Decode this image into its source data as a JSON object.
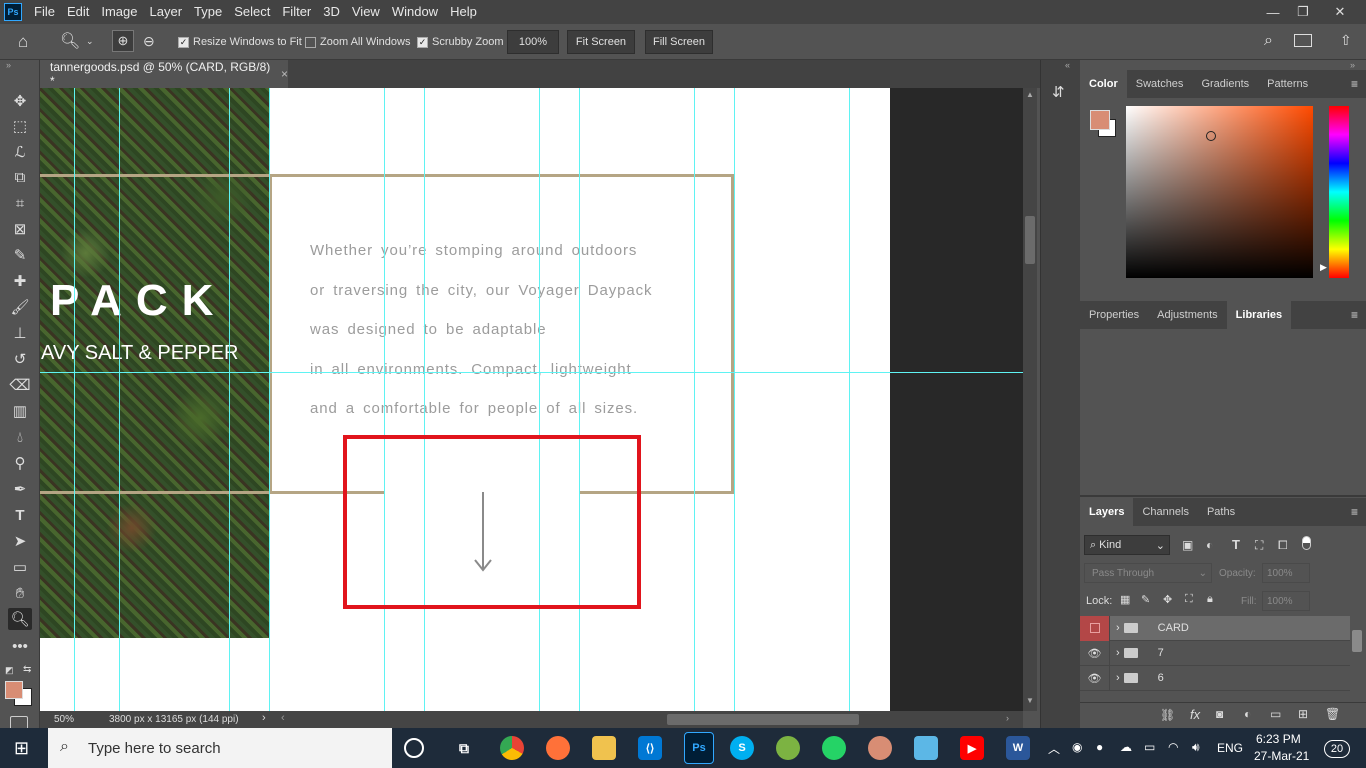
{
  "app": {
    "logo": "Ps",
    "menu": [
      "File",
      "Edit",
      "Image",
      "Layer",
      "Type",
      "Select",
      "Filter",
      "3D",
      "View",
      "Window",
      "Help"
    ],
    "window_controls": [
      "—",
      "❐",
      "✕"
    ]
  },
  "options_bar": {
    "resize_windows": "Resize Windows to Fit",
    "zoom_all": "Zoom All Windows",
    "scrubby_zoom": "Scrubby Zoom",
    "zoom_value": "100%",
    "fit_screen": "Fit Screen",
    "fill_screen": "Fill Screen"
  },
  "document": {
    "tab_title": "tannergoods.psd @ 50% (CARD, RGB/8) *",
    "close": "×",
    "heading": "PACK",
    "subheading": "AVY SALT & PEPPER",
    "paragraph": [
      "Whether you’re stomping around outdoors",
      "or traversing the city, our Voyager Daypack",
      "was designed to be adaptable",
      "in all environments. Compact, lightweight",
      "and a comfortable for people of all sizes."
    ],
    "arrow": "↓"
  },
  "status": {
    "zoom": "50%",
    "dimensions": "3800 px x 13165 px (144 ppi)"
  },
  "color_panel": {
    "tabs": [
      "Color",
      "Swatches",
      "Gradients",
      "Patterns"
    ],
    "foreground": "#d88d74",
    "hue": "#ff4a00"
  },
  "properties_panel": {
    "tabs": [
      "Properties",
      "Adjustments",
      "Libraries"
    ]
  },
  "layers_panel": {
    "tabs": [
      "Layers",
      "Channels",
      "Paths"
    ],
    "filter_kind": "Kind",
    "blend_mode": "Pass Through",
    "opacity_label": "Opacity:",
    "opacity_value": "100%",
    "lock_label": "Lock:",
    "fill_label": "Fill:",
    "fill_value": "100%",
    "layers": [
      "CARD",
      "7",
      "6"
    ]
  },
  "taskbar": {
    "search_placeholder": "Type here to search",
    "language": "ENG",
    "time": "6:23 PM",
    "date": "27-Mar-21",
    "notifications": "20"
  }
}
